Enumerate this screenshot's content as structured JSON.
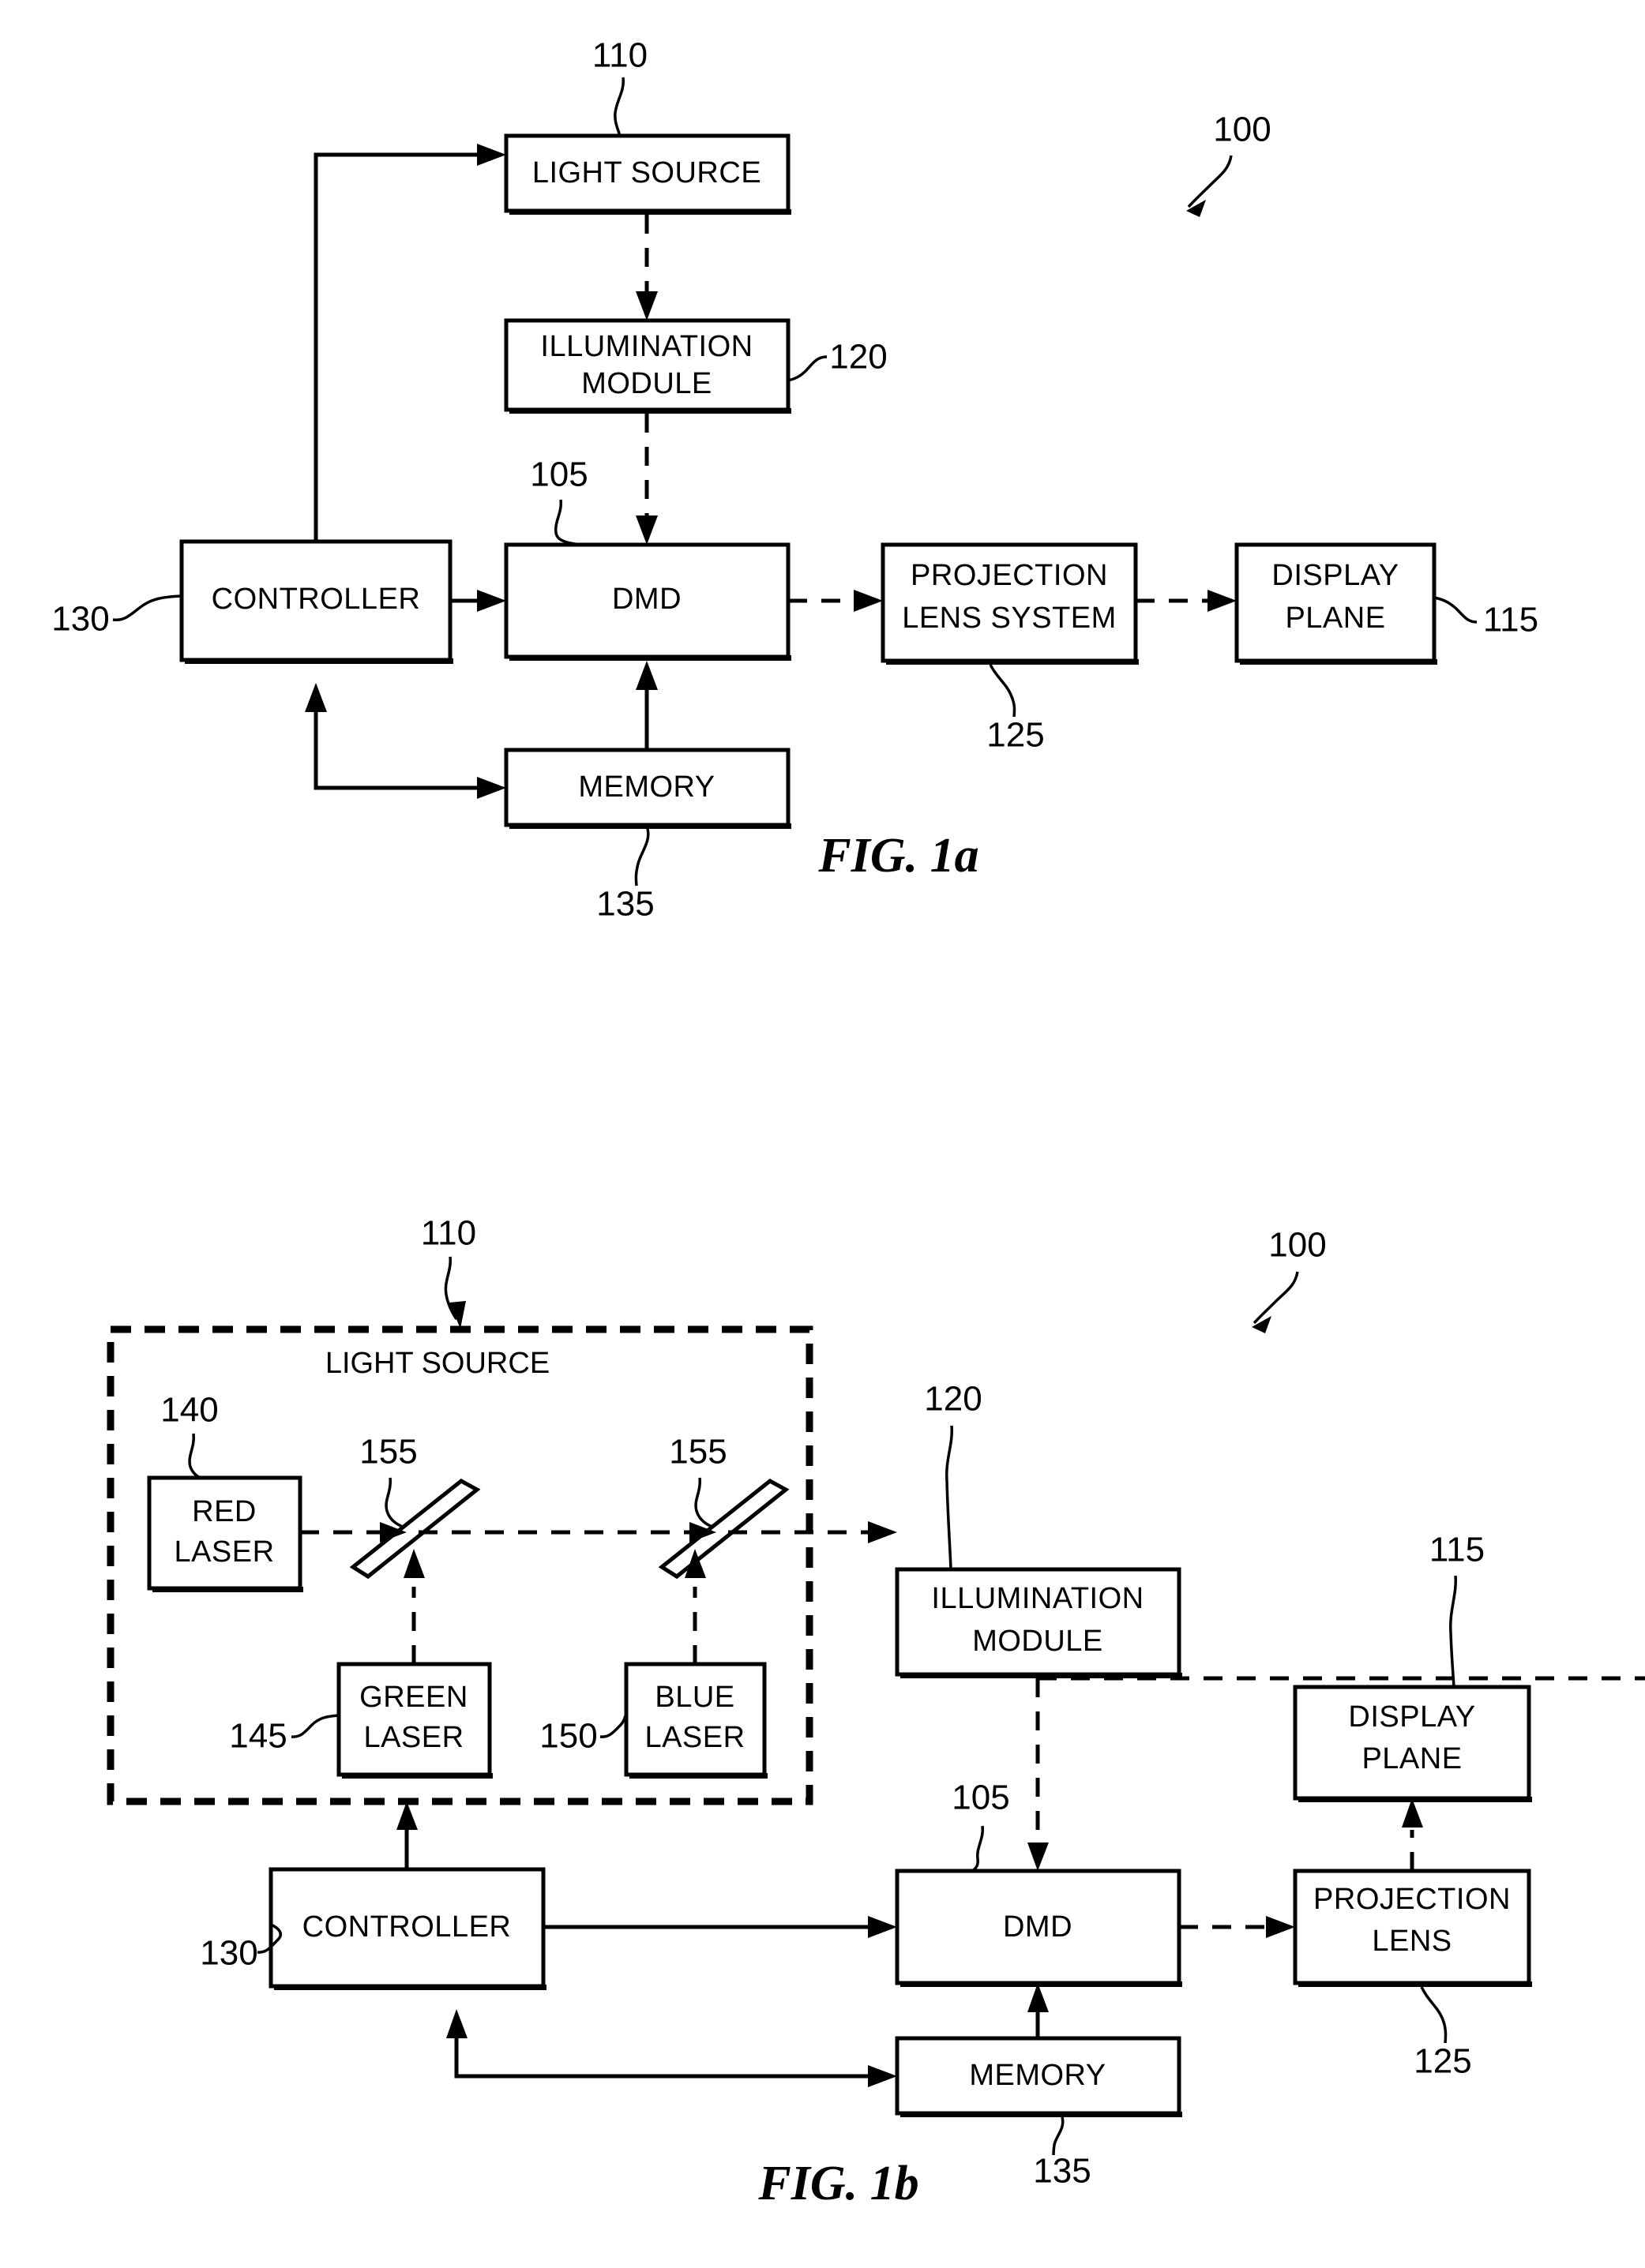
{
  "document": {
    "type": "patent-figure-sheet",
    "figures": [
      {
        "id": "fig-1a",
        "caption": "FIG. 1a",
        "system_ref": "100",
        "blocks": [
          {
            "key": "light_source",
            "label": "LIGHT SOURCE",
            "ref": "110"
          },
          {
            "key": "illumination_module",
            "label_line1": "ILLUMINATION",
            "label_line2": "MODULE",
            "ref": "120"
          },
          {
            "key": "controller",
            "label": "CONTROLLER",
            "ref": "130"
          },
          {
            "key": "dmd",
            "label": "DMD",
            "ref": "105"
          },
          {
            "key": "projection_lens_system",
            "label_line1": "PROJECTION",
            "label_line2": "LENS SYSTEM",
            "ref": "125"
          },
          {
            "key": "display_plane",
            "label_line1": "DISPLAY",
            "label_line2": "PLANE",
            "ref": "115"
          },
          {
            "key": "memory",
            "label": "MEMORY",
            "ref": "135"
          }
        ]
      },
      {
        "id": "fig-1b",
        "caption": "FIG. 1b",
        "system_ref": "100",
        "light_source_group": {
          "title": "LIGHT SOURCE",
          "ref": "110",
          "members": [
            {
              "key": "red_laser",
              "label_line1": "RED",
              "label_line2": "LASER",
              "ref": "140"
            },
            {
              "key": "green_laser",
              "label_line1": "GREEN",
              "label_line2": "LASER",
              "ref": "145"
            },
            {
              "key": "blue_laser",
              "label_line1": "BLUE",
              "label_line2": "LASER",
              "ref": "150"
            },
            {
              "key": "dichroic_mirror_1",
              "label": "",
              "ref": "155"
            },
            {
              "key": "dichroic_mirror_2",
              "label": "",
              "ref": "155"
            }
          ]
        },
        "blocks": [
          {
            "key": "illumination_module",
            "label_line1": "ILLUMINATION",
            "label_line2": "MODULE",
            "ref": "120"
          },
          {
            "key": "display_plane",
            "label_line1": "DISPLAY",
            "label_line2": "PLANE",
            "ref": "115"
          },
          {
            "key": "controller",
            "label": "CONTROLLER",
            "ref": "130"
          },
          {
            "key": "dmd",
            "label": "DMD",
            "ref": "105"
          },
          {
            "key": "projection_lens",
            "label_line1": "PROJECTION",
            "label_line2": "LENS",
            "ref": "125"
          },
          {
            "key": "memory",
            "label": "MEMORY",
            "ref": "135"
          }
        ]
      }
    ]
  },
  "fig1a": {
    "system_ref": "100",
    "light_source": {
      "label": "LIGHT SOURCE",
      "ref": "110"
    },
    "illumination_module": {
      "line1": "ILLUMINATION",
      "line2": "MODULE",
      "ref": "120"
    },
    "controller": {
      "label": "CONTROLLER",
      "ref": "130"
    },
    "dmd": {
      "label": "DMD",
      "ref": "105"
    },
    "projection_lens_system": {
      "line1": "PROJECTION",
      "line2": "LENS SYSTEM",
      "ref": "125"
    },
    "display_plane": {
      "line1": "DISPLAY",
      "line2": "PLANE",
      "ref": "115"
    },
    "memory": {
      "label": "MEMORY",
      "ref": "135"
    },
    "caption": "FIG. 1a"
  },
  "fig1b": {
    "system_ref": "100",
    "light_source_group": {
      "title": "LIGHT SOURCE",
      "ref": "110"
    },
    "red_laser": {
      "line1": "RED",
      "line2": "LASER",
      "ref": "140"
    },
    "green_laser": {
      "line1": "GREEN",
      "line2": "LASER",
      "ref": "145"
    },
    "blue_laser": {
      "line1": "BLUE",
      "line2": "LASER",
      "ref": "150"
    },
    "mirror_left": {
      "ref": "155"
    },
    "mirror_right": {
      "ref": "155"
    },
    "illumination_module": {
      "line1": "ILLUMINATION",
      "line2": "MODULE",
      "ref": "120"
    },
    "display_plane": {
      "line1": "DISPLAY",
      "line2": "PLANE",
      "ref": "115"
    },
    "controller": {
      "label": "CONTROLLER",
      "ref": "130"
    },
    "dmd": {
      "label": "DMD",
      "ref": "105"
    },
    "projection_lens": {
      "line1": "PROJECTION",
      "line2": "LENS",
      "ref": "125"
    },
    "memory": {
      "label": "MEMORY",
      "ref": "135"
    },
    "caption": "FIG. 1b"
  },
  "colors": {
    "ink": "#000000",
    "paper": "#ffffff"
  }
}
